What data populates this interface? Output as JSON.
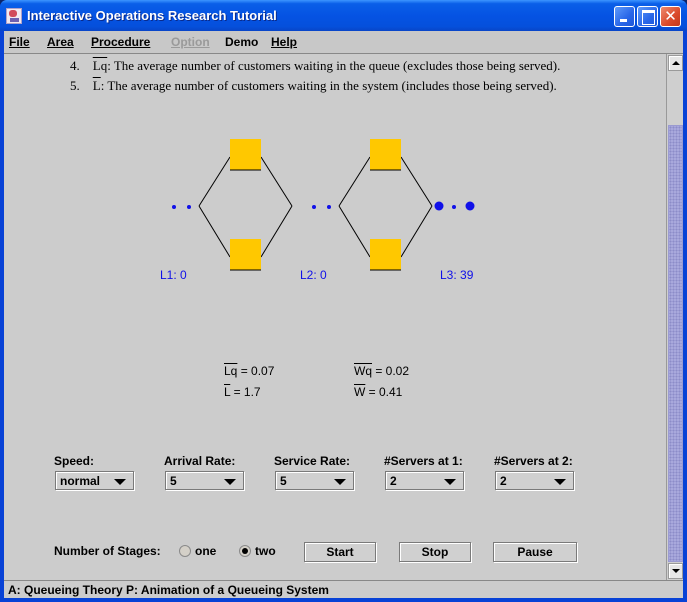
{
  "window": {
    "title": "Interactive Operations Research Tutorial",
    "icon": "java-app-icon",
    "controls": [
      "minimize",
      "maximize",
      "close"
    ]
  },
  "menubar": {
    "items": [
      {
        "label": "File",
        "enabled": true
      },
      {
        "label": "Area",
        "enabled": true
      },
      {
        "label": "Procedure",
        "enabled": true
      },
      {
        "label": "Option",
        "enabled": false
      },
      {
        "label": "Demo",
        "enabled": true
      },
      {
        "label": "Help",
        "enabled": true
      }
    ]
  },
  "definitions": [
    {
      "num": "4.",
      "symbol": "Lq",
      "text": ": The average number of customers waiting in the queue (excludes those being served)."
    },
    {
      "num": "5.",
      "symbol": "L",
      "text": ": The average number of customers waiting in the system (includes those being served)."
    }
  ],
  "animation": {
    "queues": [
      {
        "label": "L1: 0",
        "small_dots": 2,
        "large_dots": 0
      },
      {
        "label": "L2: 0",
        "small_dots": 2,
        "large_dots": 0
      },
      {
        "label": "L3: 39",
        "small_dots": 1,
        "large_dots": 2
      }
    ],
    "stages": [
      {
        "servers": 2,
        "server_color": "#ffc800"
      },
      {
        "servers": 2,
        "server_color": "#ffc800"
      }
    ],
    "customer_color": "#1010e8"
  },
  "stats": {
    "lq": {
      "symbol": "Lq",
      "value": " = 0.07"
    },
    "l": {
      "symbol": "L",
      "value": " = 1.7"
    },
    "wq": {
      "symbol": "Wq",
      "value": " = 0.02"
    },
    "w": {
      "symbol": "W",
      "value": " = 0.41"
    }
  },
  "controls": {
    "speed": {
      "label": "Speed:",
      "value": "normal"
    },
    "arrival_rate": {
      "label": "Arrival Rate:",
      "value": "5"
    },
    "service_rate": {
      "label": "Service Rate:",
      "value": "5"
    },
    "servers_1": {
      "label": "#Servers at 1:",
      "value": "2"
    },
    "servers_2": {
      "label": "#Servers at 2:",
      "value": "2"
    },
    "stages": {
      "label": "Number of Stages:",
      "options": [
        {
          "label": "one",
          "checked": false
        },
        {
          "label": "two",
          "checked": true
        }
      ]
    },
    "buttons": {
      "start": "Start",
      "stop": "Stop",
      "pause": "Pause"
    }
  },
  "statusbar": {
    "text": "A: Queueing Theory  P: Animation of a Queueing System"
  }
}
